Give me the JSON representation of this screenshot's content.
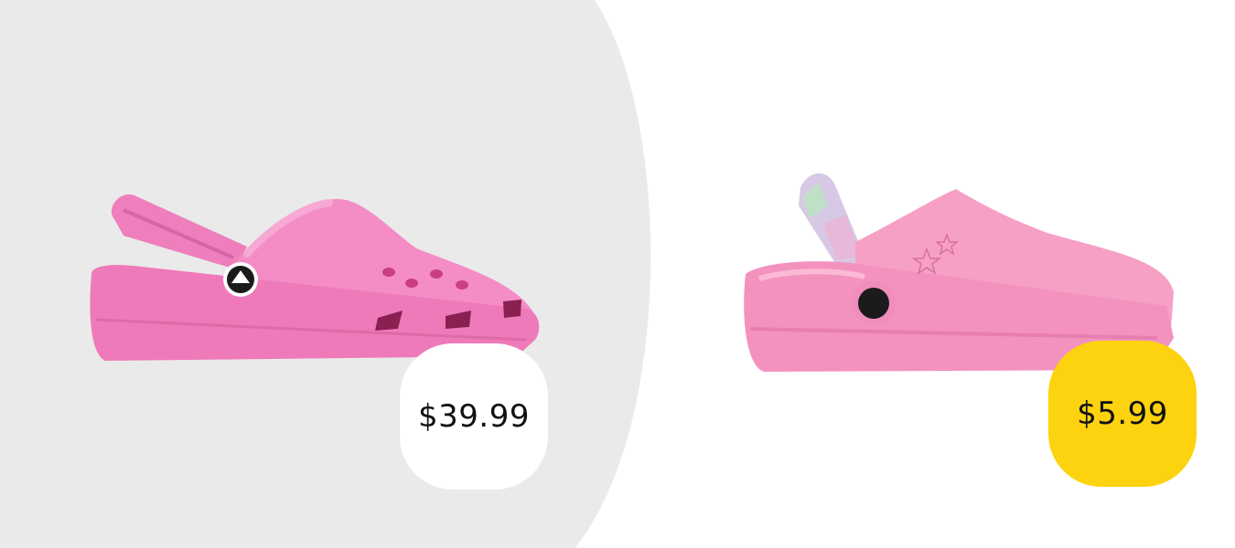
{
  "colors": {
    "left_background": "#eaeaea",
    "page_background": "#ffffff",
    "clog_pink": "#f38ac3",
    "clog_pink_right": "#f6a2c8",
    "badge_left": "#ffffff",
    "badge_right": "#fdd20e",
    "price_text": "#111111"
  },
  "products": [
    {
      "icon": "pink-classic-clog-image",
      "price": "$39.99"
    },
    {
      "icon": "pink-lookalike-clog-image",
      "price": "$5.99"
    }
  ]
}
